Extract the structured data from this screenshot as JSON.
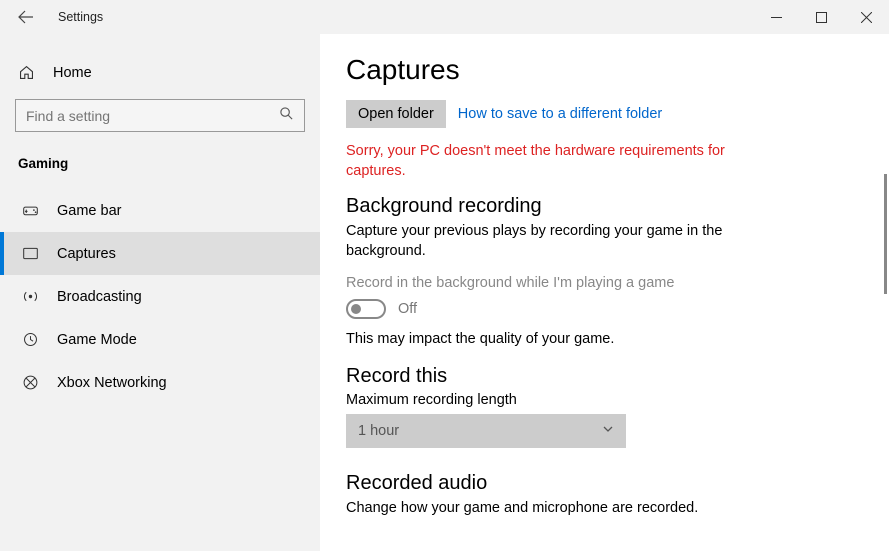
{
  "window": {
    "title": "Settings"
  },
  "sidebar": {
    "home_label": "Home",
    "search_placeholder": "Find a setting",
    "category": "Gaming",
    "items": [
      {
        "label": "Game bar"
      },
      {
        "label": "Captures"
      },
      {
        "label": "Broadcasting"
      },
      {
        "label": "Game Mode"
      },
      {
        "label": "Xbox Networking"
      }
    ]
  },
  "main": {
    "title": "Captures",
    "open_folder_label": "Open folder",
    "how_to_link": "How to save to a different folder",
    "error": "Sorry, your PC doesn't meet the hardware requirements for captures.",
    "bg_recording": {
      "heading": "Background recording",
      "desc": "Capture your previous plays by recording your game in the background.",
      "toggle_label": "Record in the background while I'm playing a game",
      "toggle_state": "Off",
      "note": "This may impact the quality of your game."
    },
    "record_this": {
      "heading": "Record this",
      "field_label": "Maximum recording length",
      "selected": "1 hour"
    },
    "recorded_audio": {
      "heading": "Recorded audio",
      "desc": "Change how your game and microphone are recorded."
    }
  }
}
